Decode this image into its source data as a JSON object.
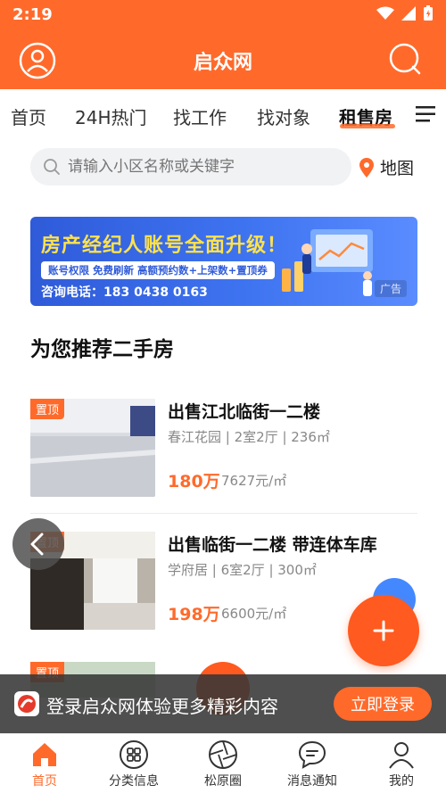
{
  "status": {
    "time": "2:19"
  },
  "header": {
    "title": "启众网"
  },
  "tabs": [
    {
      "label": "首页"
    },
    {
      "label": "24H热门"
    },
    {
      "label": "找工作"
    },
    {
      "label": "找对象"
    },
    {
      "label": "租售房"
    }
  ],
  "search": {
    "placeholder": "请输入小区名称或关键字",
    "map_label": "地图"
  },
  "banner": {
    "title": "房产经纪人账号全面升级！",
    "pill": "账号权限  免费刷新  高额预约数+上架数+置顶券",
    "phone": "咨询电话：183 0438 0163",
    "ad": "广告"
  },
  "section": {
    "title": "为您推荐二手房"
  },
  "listings": [
    {
      "badge": "置顶",
      "title": "出售江北临街一二楼",
      "meta": "春江花园 | 2室2厅 | 236㎡",
      "price": "180万",
      "unit_price": "7627元/㎡"
    },
    {
      "badge": "置顶",
      "title": "出售临街一二楼 带连体车库",
      "meta": "学府居 | 6室2厅 | 300㎡",
      "price": "198万",
      "unit_price": "6600元/㎡"
    }
  ],
  "partial_listing": {
    "badge": "置顶"
  },
  "login": {
    "text": "登录启众网体验更多精彩内容",
    "button": "立即登录"
  },
  "bottom_nav": [
    {
      "label": "首页",
      "icon": "home-icon"
    },
    {
      "label": "分类信息",
      "icon": "grid-icon"
    },
    {
      "label": "松原圈",
      "icon": "camera-shutter-icon"
    },
    {
      "label": "消息通知",
      "icon": "chat-icon"
    },
    {
      "label": "我的",
      "icon": "user-icon"
    }
  ],
  "colors": {
    "brand": "#ff6a2b",
    "banner_blue": "#2f5bd9"
  }
}
